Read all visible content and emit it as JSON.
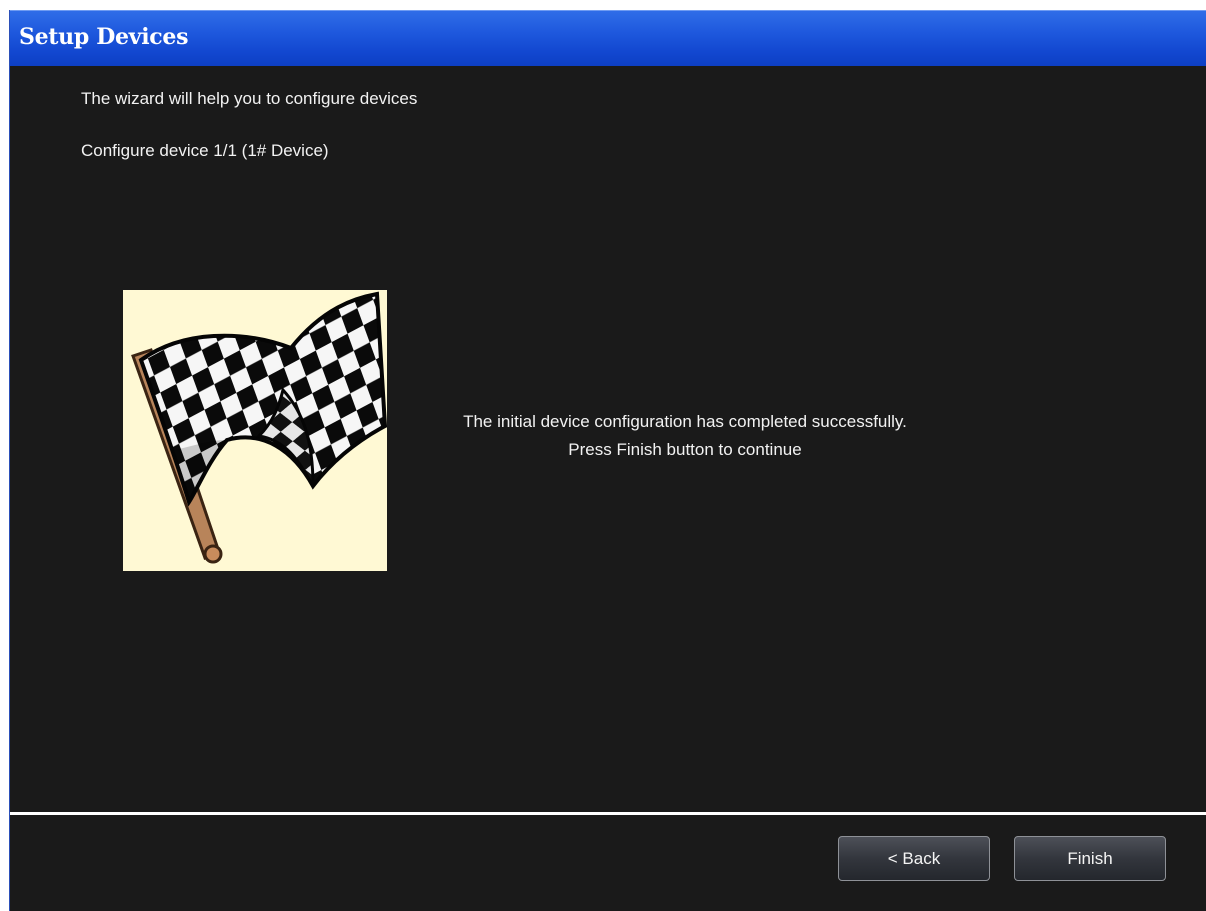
{
  "window": {
    "title": "Setup Devices",
    "accent_color": "#1e58dd",
    "background_color": "#1a1a1a"
  },
  "wizard": {
    "intro": "The wizard will help you to configure devices",
    "progress": "Configure device 1/1 (1# Device)",
    "image_icon": "checkered-flag-icon",
    "message_line1": "The initial device configuration has completed successfully.",
    "message_line2": "Press Finish button to continue"
  },
  "footer": {
    "back_label": "< Back",
    "finish_label": "Finish"
  }
}
